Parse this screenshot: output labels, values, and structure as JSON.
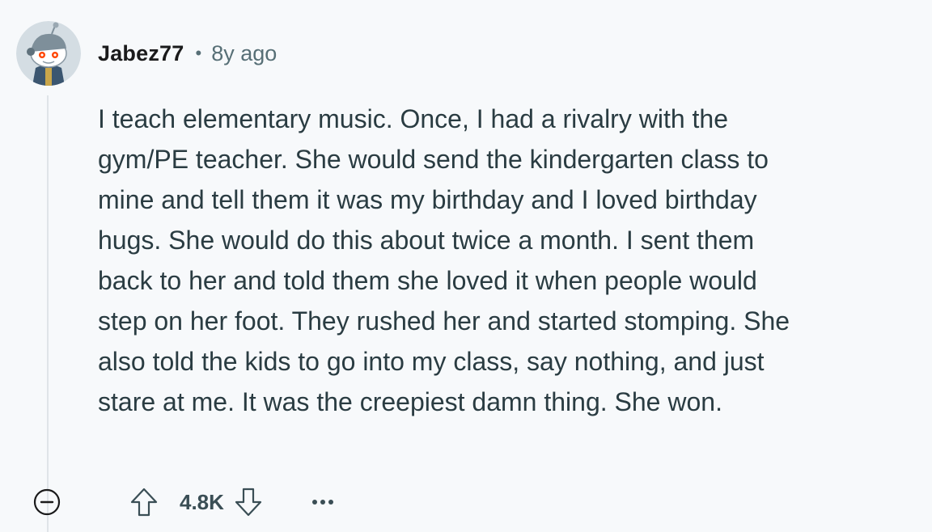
{
  "comment": {
    "author": "Jabez77",
    "separator": "•",
    "age": "8y ago",
    "body": "I teach elementary music. Once, I had a rivalry with the gym/PE teacher. She would send the kindergarten class to mine and tell them it was my birthday and I loved birthday hugs. She would do this about twice a month. I sent them back to her and told them she loved it when people would step on her foot. They rushed her and started stomping. She also told the kids to go into my class, say nothing, and just stare at me. It was the creepiest damn thing. She won.",
    "score": "4.8K"
  },
  "icons": {
    "avatar": "reddit-snoo-avatar",
    "collapse": "minus-circle-icon",
    "upvote": "arrow-up-icon",
    "downvote": "arrow-down-icon",
    "more": "ellipsis-icon"
  },
  "colors": {
    "background": "#f7f9fb",
    "text": "#2a3c42",
    "meta_text": "#576f76",
    "icon": "#3a4e55",
    "thread_line": "#dfe4e8"
  }
}
